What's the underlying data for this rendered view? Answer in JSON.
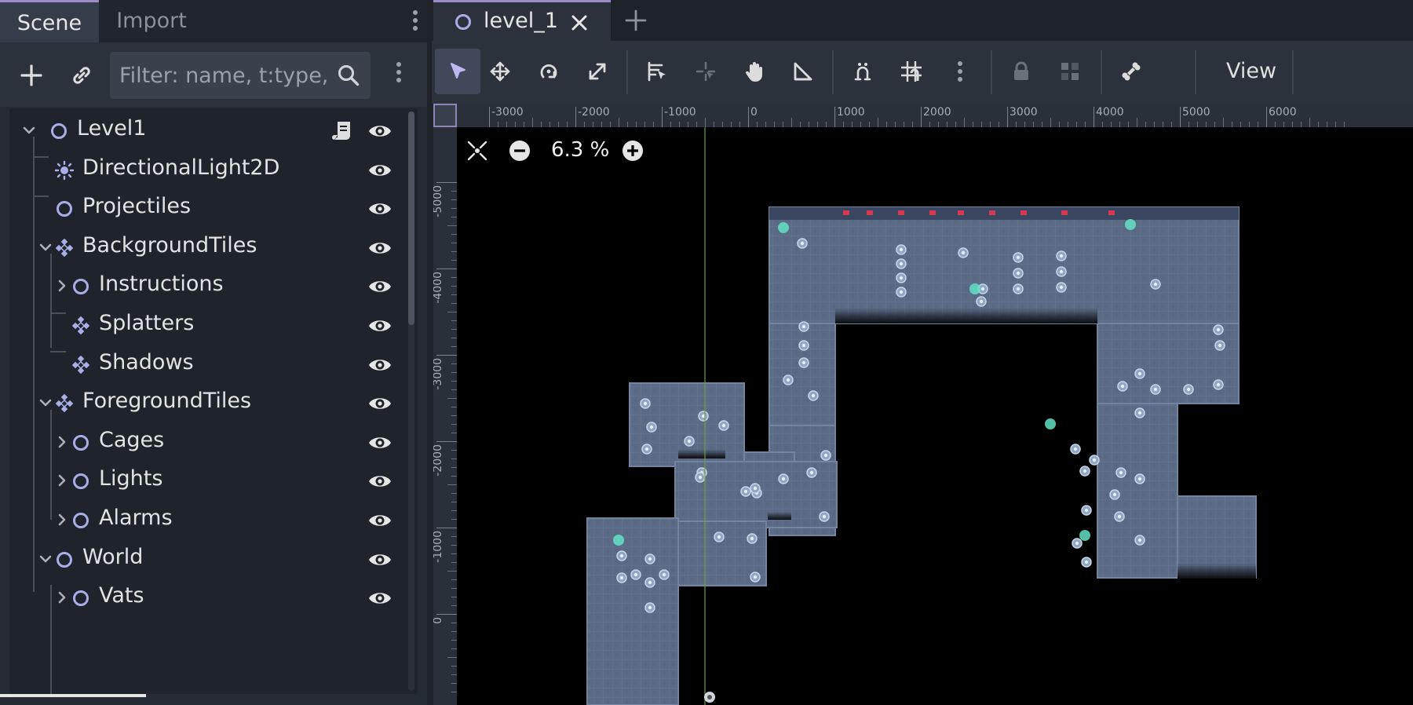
{
  "left_dock": {
    "tabs": [
      {
        "label": "Scene",
        "active": true
      },
      {
        "label": "Import",
        "active": false
      }
    ],
    "filter": {
      "placeholder": "Filter: name, t:type,"
    },
    "tree": [
      {
        "label": "Level1",
        "icon": "node-circle-icon",
        "depth": 0,
        "expanded": true,
        "has_script": true,
        "visible": true
      },
      {
        "label": "DirectionalLight2D",
        "icon": "light-sun-icon",
        "depth": 1,
        "visible": true
      },
      {
        "label": "Projectiles",
        "icon": "node-circle-icon",
        "depth": 1,
        "visible": true
      },
      {
        "label": "BackgroundTiles",
        "icon": "tilemap-icon",
        "depth": 1,
        "expanded": true,
        "visible": true
      },
      {
        "label": "Instructions",
        "icon": "node-circle-icon",
        "depth": 2,
        "collapsed": true,
        "visible": true
      },
      {
        "label": "Splatters",
        "icon": "tilemap-icon",
        "depth": 2,
        "visible": true
      },
      {
        "label": "Shadows",
        "icon": "tilemap-icon",
        "depth": 2,
        "visible": true
      },
      {
        "label": "ForegroundTiles",
        "icon": "tilemap-icon",
        "depth": 1,
        "expanded": true,
        "visible": true
      },
      {
        "label": "Cages",
        "icon": "node-circle-icon",
        "depth": 2,
        "collapsed": true,
        "visible": true
      },
      {
        "label": "Lights",
        "icon": "node-circle-icon",
        "depth": 2,
        "collapsed": true,
        "visible": true
      },
      {
        "label": "Alarms",
        "icon": "node-circle-icon",
        "depth": 2,
        "collapsed": true,
        "visible": true
      },
      {
        "label": "World",
        "icon": "node-circle-icon",
        "depth": 1,
        "expanded": true,
        "visible": true
      },
      {
        "label": "Vats",
        "icon": "node-circle-icon",
        "depth": 2,
        "collapsed": true,
        "visible": true
      }
    ]
  },
  "editor": {
    "scene_tab": {
      "label": "level_1"
    },
    "toolbar": {
      "tools": [
        "select-tool-icon",
        "move-tool-icon",
        "rotate-tool-icon",
        "scale-tool-icon",
        "list-select-icon",
        "pivot-icon",
        "pan-hand-icon",
        "ruler-icon",
        "smart-snap-icon",
        "grid-snap-icon",
        "more-icon",
        "lock-icon",
        "group-icon",
        "bone-icon"
      ],
      "view_label": "View"
    },
    "zoom": {
      "label": "6.3 %"
    },
    "ruler_top": [
      "-3000",
      "-2000",
      "-1000",
      "0",
      "1000",
      "2000",
      "3000",
      "4000",
      "5000",
      "6000"
    ],
    "ruler_left": [
      "-5000",
      "-4000",
      "-3000",
      "-2000",
      "-1000",
      "0"
    ]
  },
  "colors": {
    "accent": "#9a8dc7",
    "icon": "#a9aee8",
    "floor": "#5b6b86",
    "floor_light": "#7384a3"
  }
}
